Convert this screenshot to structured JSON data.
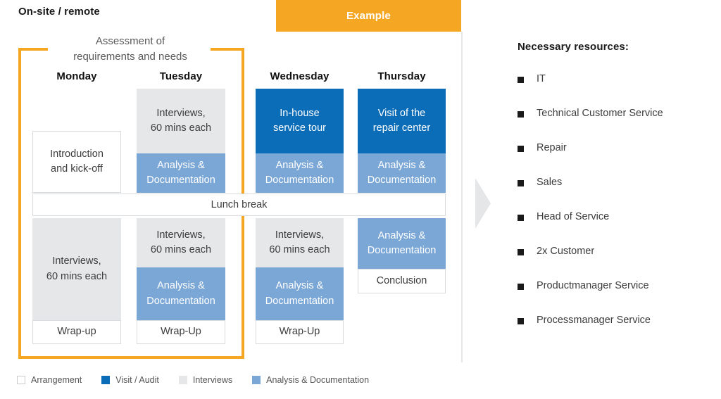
{
  "header": {
    "onsite_title": "On-site / remote",
    "example_banner": "Example"
  },
  "assessment": {
    "label": "Assessment of\nrequirements and needs",
    "line1": "Assessment of",
    "line2": "requirements and needs",
    "bracket_color": "#F5A623"
  },
  "schedule": {
    "lunch_label": "Lunch break",
    "days": [
      {
        "name": "Monday",
        "morning": [
          {
            "label": "Introduction\nand kick-off",
            "type": "arrangement"
          }
        ],
        "afternoon": [
          {
            "label": "Interviews,\n60 mins each",
            "type": "interviews"
          },
          {
            "label": "Wrap-up",
            "type": "arrangement"
          }
        ]
      },
      {
        "name": "Tuesday",
        "morning": [
          {
            "label": "Interviews,\n60 mins each",
            "type": "interviews"
          },
          {
            "label": "Analysis &\nDocumentation",
            "type": "analysis"
          }
        ],
        "afternoon": [
          {
            "label": "Interviews,\n60 mins each",
            "type": "interviews"
          },
          {
            "label": "Analysis &\nDocumentation",
            "type": "analysis"
          },
          {
            "label": "Wrap-Up",
            "type": "arrangement"
          }
        ]
      },
      {
        "name": "Wednesday",
        "morning": [
          {
            "label": "In-house\nservice tour",
            "type": "visit"
          },
          {
            "label": "Analysis &\nDocumentation",
            "type": "analysis"
          }
        ],
        "afternoon": [
          {
            "label": "Interviews,\n60 mins each",
            "type": "interviews"
          },
          {
            "label": "Analysis &\nDocumentation",
            "type": "analysis"
          },
          {
            "label": "Wrap-Up",
            "type": "arrangement"
          }
        ]
      },
      {
        "name": "Thursday",
        "morning": [
          {
            "label": "Visit of the\nrepair center",
            "type": "visit"
          },
          {
            "label": "Analysis &\nDocumentation",
            "type": "analysis"
          }
        ],
        "afternoon": [
          {
            "label": "Analysis &\nDocumentation",
            "type": "analysis"
          },
          {
            "label": "Conclusion",
            "type": "arrangement"
          }
        ]
      }
    ]
  },
  "blocks": {
    "mon_intro_l1": "Introduction",
    "mon_intro_l2": "and kick-off",
    "mon_pm_l1": "Interviews,",
    "mon_pm_l2": "60 mins each",
    "mon_wrap": "Wrap-up",
    "tue_am_l1": "Interviews,",
    "tue_am_l2": "60 mins each",
    "tue_am_an_l1": "Analysis &",
    "tue_am_an_l2": "Documentation",
    "tue_pm_l1": "Interviews,",
    "tue_pm_l2": "60 mins each",
    "tue_pm_an_l1": "Analysis &",
    "tue_pm_an_l2": "Documentation",
    "tue_wrap": "Wrap-Up",
    "wed_am_l1": "In-house",
    "wed_am_l2": "service tour",
    "wed_am_an_l1": "Analysis &",
    "wed_am_an_l2": "Documentation",
    "wed_pm_l1": "Interviews,",
    "wed_pm_l2": "60 mins each",
    "wed_pm_an_l1": "Analysis &",
    "wed_pm_an_l2": "Documentation",
    "wed_wrap": "Wrap-Up",
    "thu_am_l1": "Visit of the",
    "thu_am_l2": "repair center",
    "thu_am_an_l1": "Analysis &",
    "thu_am_an_l2": "Documentation",
    "thu_pm_an_l1": "Analysis &",
    "thu_pm_an_l2": "Documentation",
    "thu_conclusion": "Conclusion"
  },
  "day_names": {
    "monday": "Monday",
    "tuesday": "Tuesday",
    "wednesday": "Wednesday",
    "thursday": "Thursday"
  },
  "resources": {
    "title": "Necessary resources:",
    "items": [
      {
        "label": "IT"
      },
      {
        "label": "Technical Customer Service"
      },
      {
        "label": "Repair"
      },
      {
        "label": "Sales"
      },
      {
        "label": "Head of Service"
      },
      {
        "label": "2x Customer"
      },
      {
        "label": "Productmanager Service"
      },
      {
        "label": "Processmanager Service"
      }
    ]
  },
  "legend": {
    "items": [
      {
        "label": "Arrangement",
        "color": "#ffffff"
      },
      {
        "label": "Visit / Audit",
        "color": "#0B6CB7"
      },
      {
        "label": "Interviews",
        "color": "#e6e7e8"
      },
      {
        "label": "Analysis & Documentation",
        "color": "#7BA7D7"
      }
    ]
  },
  "colors": {
    "orange": "#F5A623",
    "blue_dark": "#0B6CB7",
    "blue_mid": "#7BA7D7",
    "gray": "#e6e7e8",
    "arrow": "#e4e6e8"
  }
}
